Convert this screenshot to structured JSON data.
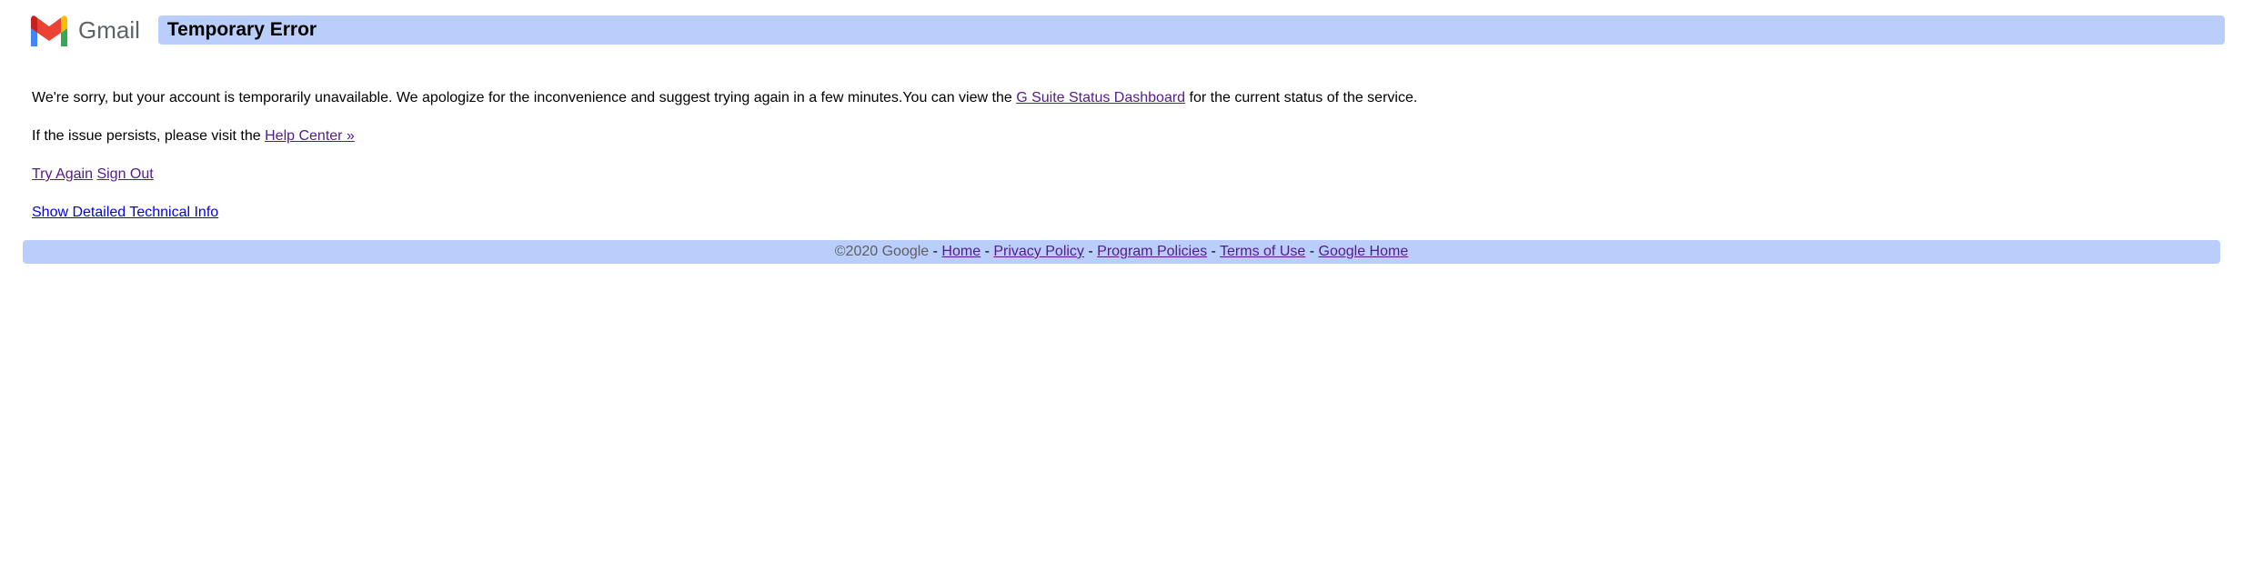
{
  "header": {
    "logo_text": "Gmail",
    "title": "Temporary Error"
  },
  "body": {
    "apology_part1": "We're sorry, but your account is temporarily unavailable. We apologize for the inconvenience and suggest trying again in a few minutes.You can view the ",
    "status_link": "G Suite Status Dashboard",
    "apology_part2": " for the current status of the service.",
    "persist_text": "If the issue persists, please visit the ",
    "help_center_link": "Help Center »",
    "try_again": "Try Again",
    "sign_out": "Sign Out",
    "tech_info_link": "Show Detailed Technical Info"
  },
  "footer": {
    "copyright": "©2020 Google",
    "links": {
      "home": "Home",
      "privacy": "Privacy Policy",
      "program": "Program Policies",
      "terms": "Terms of Use",
      "google_home": "Google Home"
    }
  }
}
